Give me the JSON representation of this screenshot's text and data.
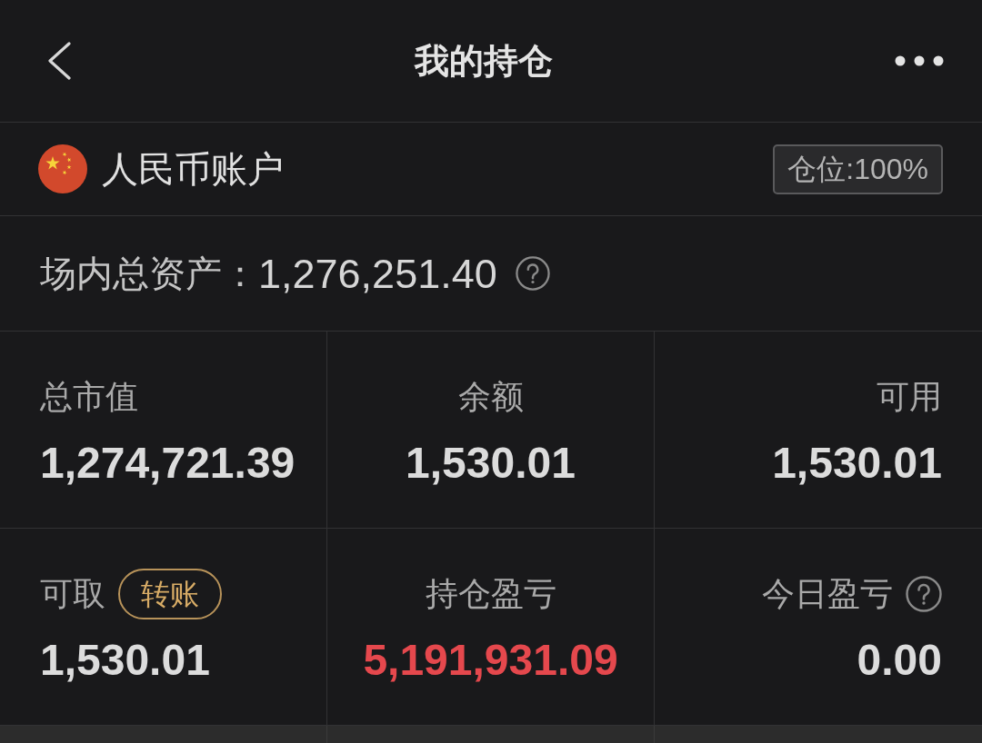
{
  "header": {
    "title": "我的持仓"
  },
  "account": {
    "name": "人民币账户",
    "position": "仓位:100%"
  },
  "total_assets": {
    "label": "场内总资产：",
    "value": "1,276,251.40",
    "help": true
  },
  "stats": [
    {
      "label": "总市值",
      "value": "1,274,721.39",
      "color": "#dcdcdc",
      "help": false
    },
    {
      "label": "余额",
      "value": "1,530.01",
      "color": "#dcdcdc",
      "help": false
    },
    {
      "label": "可用",
      "value": "1,530.01",
      "color": "#dcdcdc",
      "help": false
    },
    {
      "label": "可取",
      "action": "转账",
      "value": "1,530.01",
      "color": "#dcdcdc",
      "help": false
    },
    {
      "label": "持仓盈亏",
      "value": "5,191,931.09",
      "color": "#e5484d",
      "help": false
    },
    {
      "label": "今日盈亏",
      "value": "0.00",
      "color": "#dcdcdc",
      "help": true
    }
  ]
}
